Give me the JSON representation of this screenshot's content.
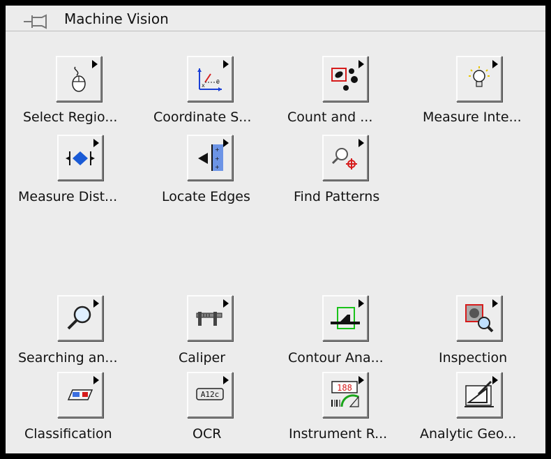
{
  "window": {
    "title": "Machine Vision",
    "pin_icon": "pushpin-icon"
  },
  "items": [
    {
      "label": "Select Regio...",
      "icon": "mouse-select-icon"
    },
    {
      "label": "Coordinate S...",
      "icon": "coordinate-system-icon"
    },
    {
      "label": "Count and ...",
      "icon": "count-blobs-icon"
    },
    {
      "label": "Measure Inte...",
      "icon": "lightbulb-icon"
    },
    {
      "label": "Measure Dist...",
      "icon": "measure-distance-icon"
    },
    {
      "label": "Locate Edges",
      "icon": "locate-edges-icon"
    },
    {
      "label": "Find Patterns",
      "icon": "find-patterns-icon"
    },
    {
      "label": "Searching an...",
      "icon": "magnifier-icon"
    },
    {
      "label": "Caliper",
      "icon": "caliper-icon"
    },
    {
      "label": "Contour Ana...",
      "icon": "contour-analysis-icon"
    },
    {
      "label": "Inspection",
      "icon": "inspection-icon"
    },
    {
      "label": "Classification",
      "icon": "classification-icon"
    },
    {
      "label": "OCR",
      "icon": "ocr-icon",
      "icon_text": "A12c"
    },
    {
      "label": "Instrument R...",
      "icon": "instrument-reader-icon",
      "icon_text": "188"
    },
    {
      "label": "Analytic Geo...",
      "icon": "analytic-geometry-icon"
    }
  ]
}
